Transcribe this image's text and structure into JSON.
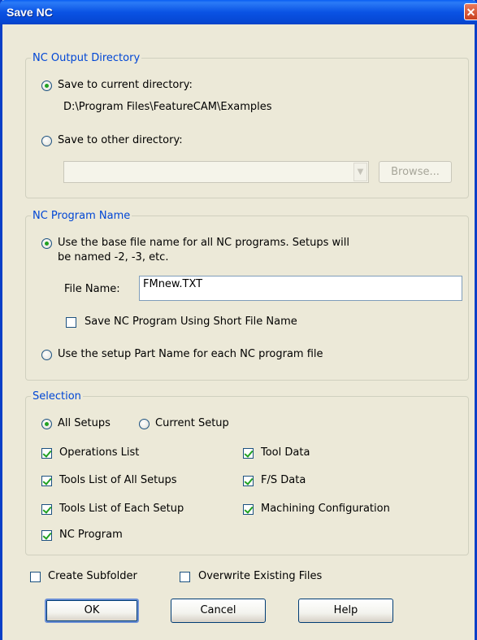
{
  "window": {
    "title": "Save NC",
    "close_glyph": "✕"
  },
  "output_directory": {
    "legend": "NC Output Directory",
    "current_label": "Save to current directory:",
    "current_path": "D:\\Program Files\\FeatureCAM\\Examples",
    "other_label": "Save to other directory:",
    "other_value": "",
    "browse_label": "Browse...",
    "selected": "current"
  },
  "program_name": {
    "legend": "NC Program Name",
    "base_label_line1": "Use the base file name for all NC programs.  Setups will",
    "base_label_line2": "be named -2, -3, etc.",
    "file_name_label": "File Name:",
    "file_name_value": "FMnew.TXT",
    "short_name_label": "Save NC Program Using Short File Name",
    "short_name_checked": false,
    "setup_part_label": "Use the setup Part Name for each NC program file",
    "selected": "base"
  },
  "selection": {
    "legend": "Selection",
    "all_setups_label": "All Setups",
    "current_setup_label": "Current Setup",
    "selected": "all",
    "options": {
      "operations_list": {
        "label": "Operations List",
        "checked": true
      },
      "tool_data": {
        "label": "Tool Data",
        "checked": true
      },
      "tools_all": {
        "label": "Tools List of All Setups",
        "checked": true
      },
      "fs_data": {
        "label": "F/S Data",
        "checked": true
      },
      "tools_each": {
        "label": "Tools List of Each Setup",
        "checked": true
      },
      "machining_config": {
        "label": "Machining Configuration",
        "checked": true
      },
      "nc_program": {
        "label": "NC Program",
        "checked": true
      }
    }
  },
  "footer": {
    "create_subfolder_label": "Create Subfolder",
    "create_subfolder_checked": false,
    "overwrite_label": "Overwrite Existing Files",
    "overwrite_checked": false
  },
  "buttons": {
    "ok": "OK",
    "cancel": "Cancel",
    "help": "Help"
  },
  "colors": {
    "titlebar": "#0a53e4",
    "group_legend": "#0046d5",
    "check_mark": "#21a121",
    "dialog_bg": "#ece9d8"
  },
  "icons": {
    "close": "close-icon",
    "dropdown": "chevron-down-icon"
  }
}
